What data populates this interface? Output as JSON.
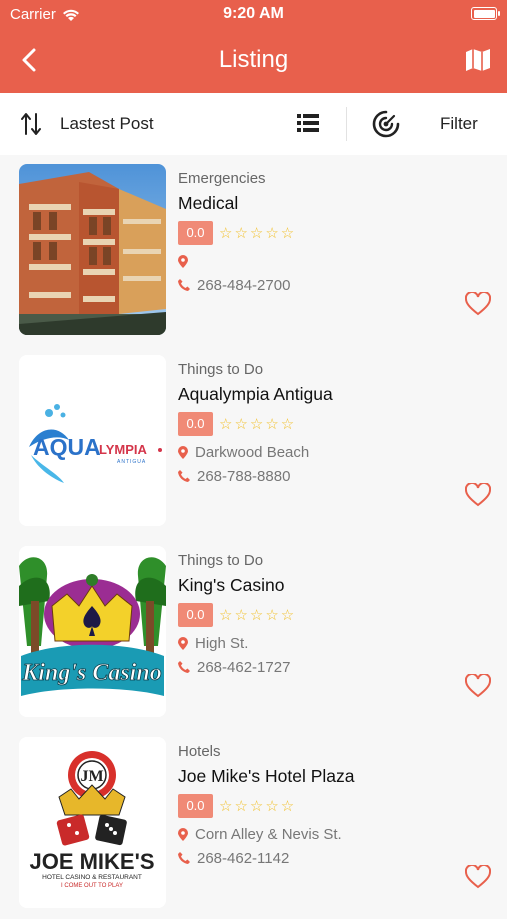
{
  "status_bar": {
    "carrier": "Carrier",
    "time": "9:20 AM"
  },
  "navbar": {
    "title": "Listing"
  },
  "toolbar": {
    "sort_label": "Lastest Post",
    "filter_label": "Filter"
  },
  "listings": [
    {
      "category": "Emergencies",
      "name": "Medical",
      "rating": "0.0",
      "stars": "☆☆☆☆☆",
      "address": "",
      "phone": "268-484-2700"
    },
    {
      "category": "Things to Do",
      "name": "Aqualympia Antigua",
      "rating": "0.0",
      "stars": "☆☆☆☆☆",
      "address": "Darkwood Beach",
      "phone": "268-788-8880"
    },
    {
      "category": "Things to Do",
      "name": "King's Casino",
      "rating": "0.0",
      "stars": "☆☆☆☆☆",
      "address": "High St.",
      "phone": "268-462-1727"
    },
    {
      "category": "Hotels",
      "name": "Joe Mike's Hotel Plaza",
      "rating": "0.0",
      "stars": "☆☆☆☆☆",
      "address": "Corn Alley & Nevis St.",
      "phone": "268-462-1142"
    }
  ],
  "logos": {
    "aqua": {
      "main": "AQUA",
      "rest": "LYMPIA",
      "sub": "ANTIGUA"
    },
    "kings": {
      "text": "King's Casino"
    },
    "joemike": {
      "monogram": "JM",
      "main": "JOE MIKE'S",
      "sub": "HOTEL CASINO & RESTAURANT",
      "tag": "I COME OUT TO PLAY"
    }
  },
  "colors": {
    "accent": "#e8604c",
    "badge": "#f08a76",
    "star": "#f2c12e",
    "pin": "#e8604c"
  }
}
